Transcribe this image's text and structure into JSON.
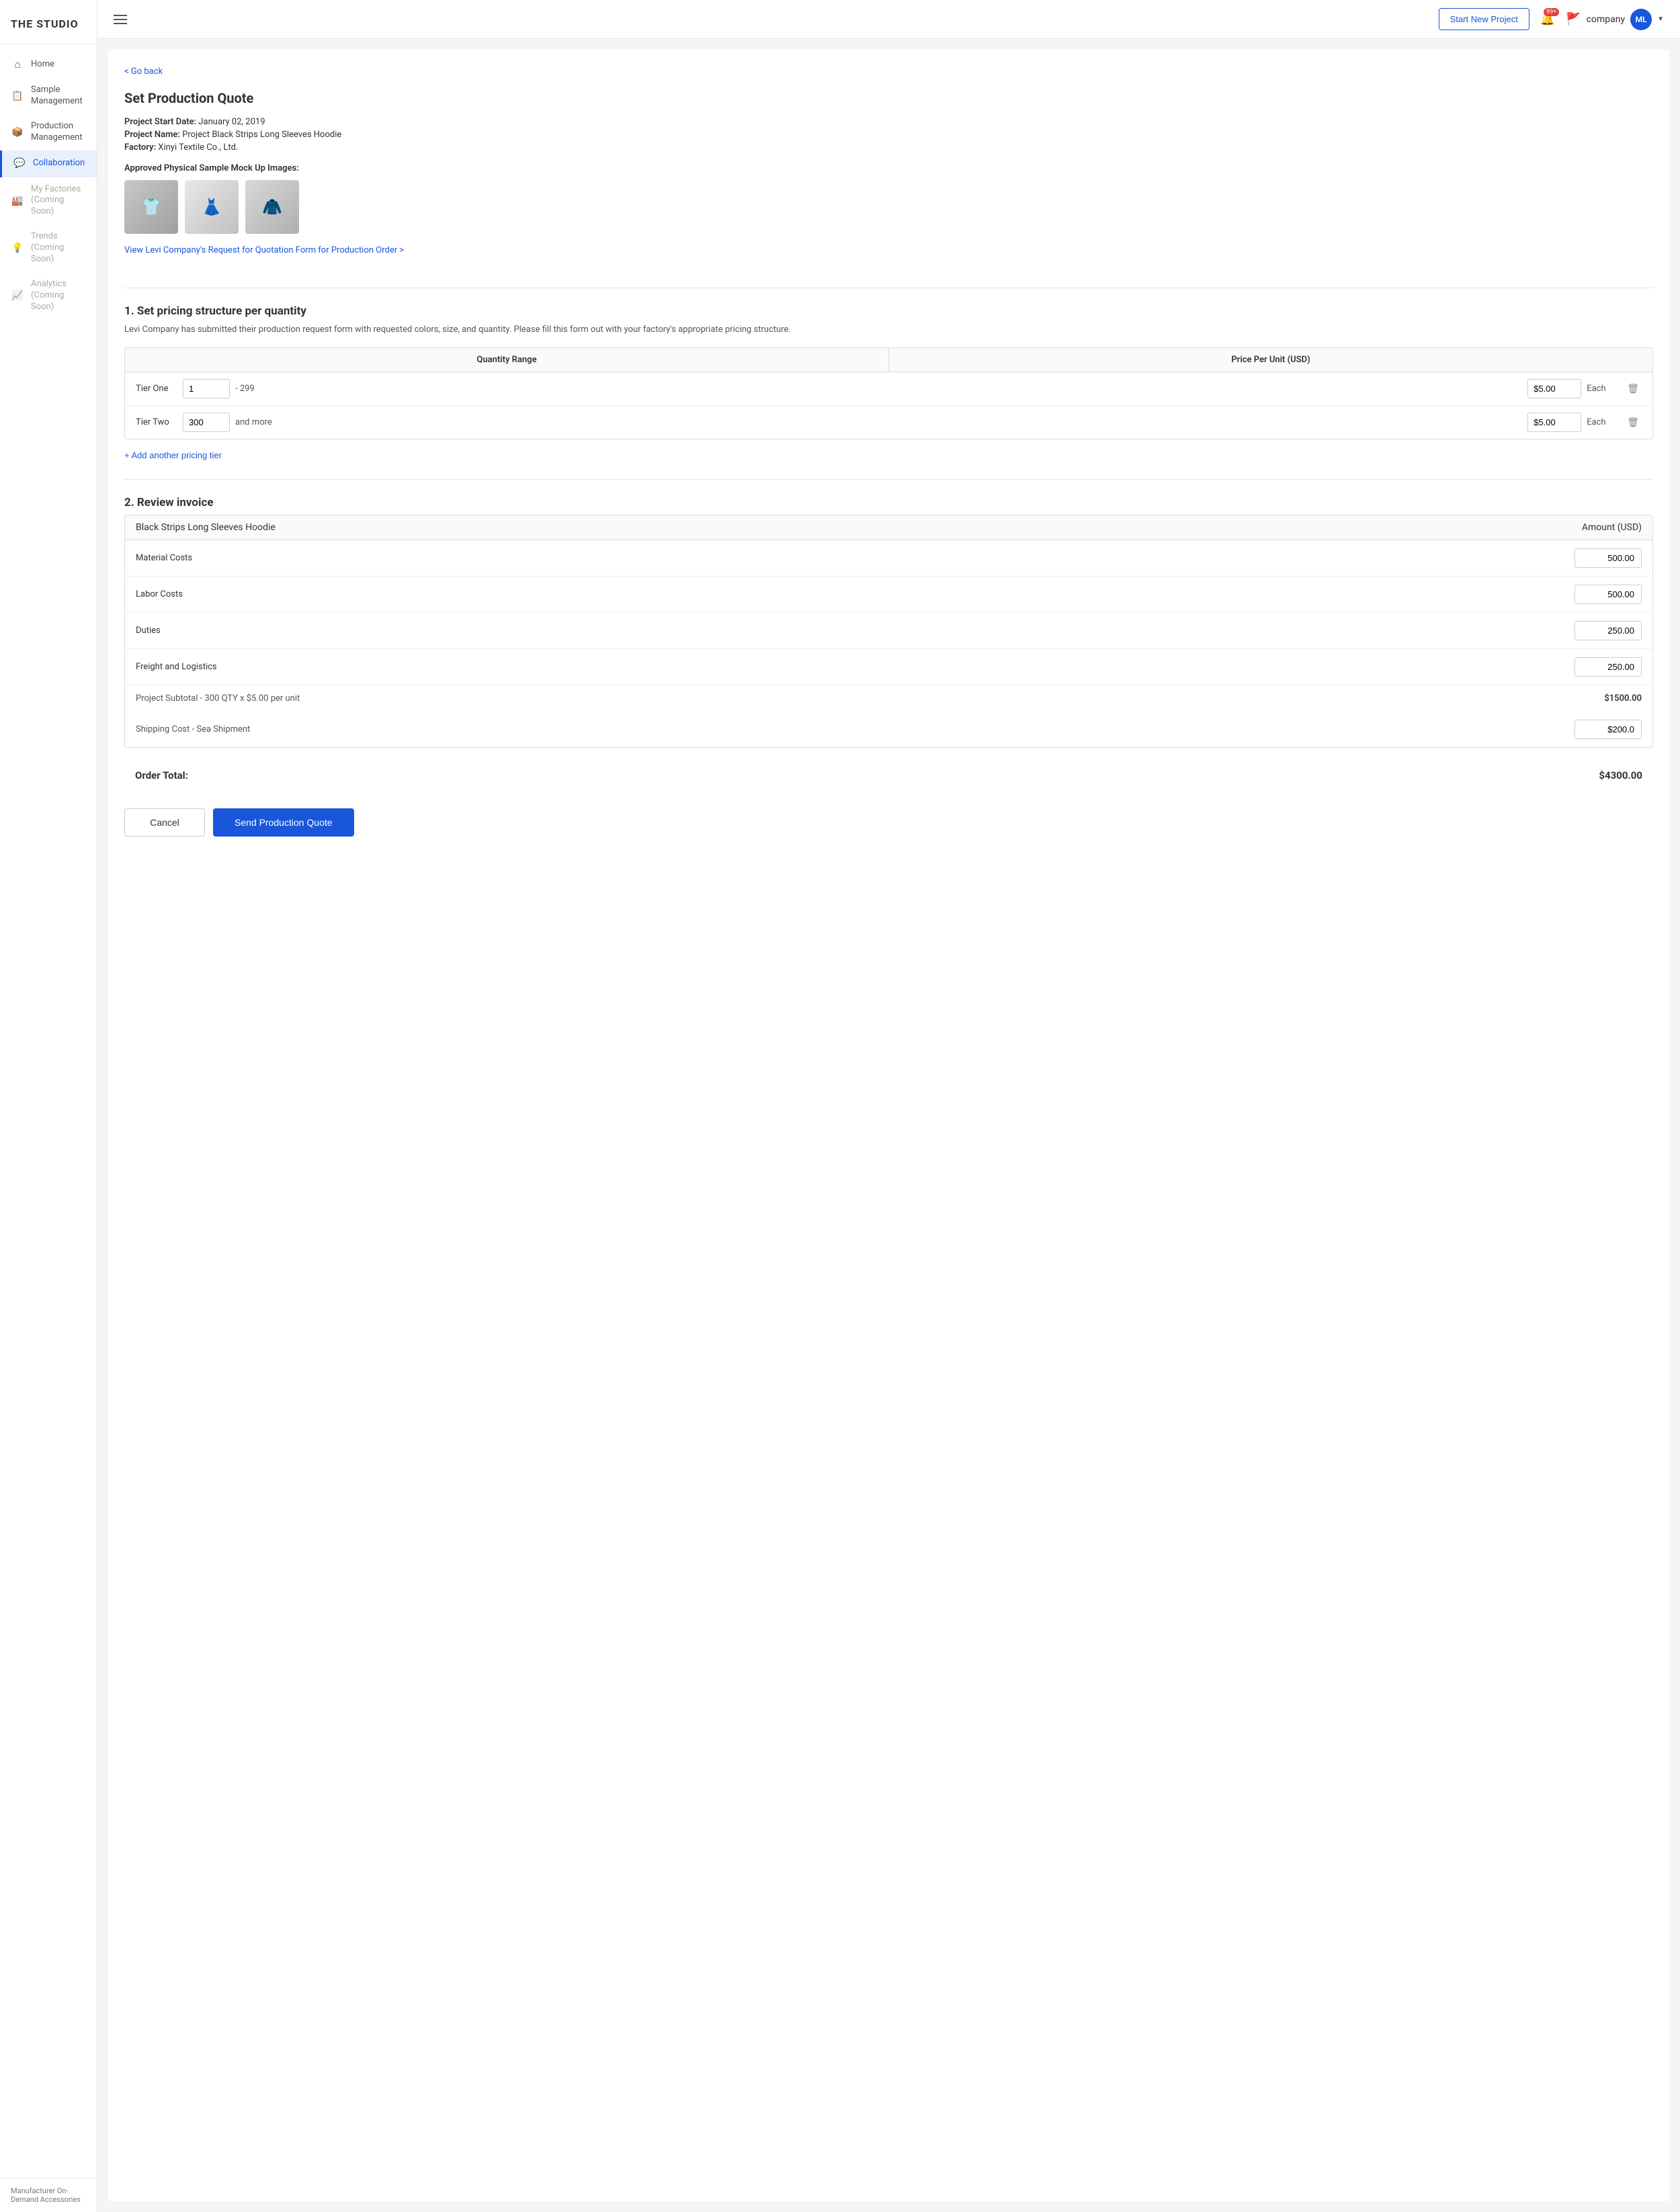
{
  "app": {
    "logo": "THE STUDIO"
  },
  "header": {
    "start_new_project": "Start New Project",
    "notification_count": "99+",
    "company_name": "company",
    "user_initials": "ML"
  },
  "sidebar": {
    "items": [
      {
        "id": "home",
        "label": "Home",
        "icon": "home",
        "active": false,
        "disabled": false
      },
      {
        "id": "sample-management",
        "label": "Sample Management",
        "icon": "sample",
        "active": false,
        "disabled": false
      },
      {
        "id": "production-management",
        "label": "Production Management",
        "icon": "production",
        "active": false,
        "disabled": false
      },
      {
        "id": "collaboration",
        "label": "Collaboration",
        "icon": "collab",
        "active": true,
        "disabled": false
      },
      {
        "id": "my-factories",
        "label": "My Factories (Coming Soon)",
        "icon": "factory",
        "active": false,
        "disabled": true
      },
      {
        "id": "trends",
        "label": "Trends (Coming Soon)",
        "icon": "trends",
        "active": false,
        "disabled": true
      },
      {
        "id": "analytics",
        "label": "Analytics (Coming Soon)",
        "icon": "analytics",
        "active": false,
        "disabled": true
      }
    ],
    "footer_label": "Manufacturer On-Demand Accessories"
  },
  "page": {
    "go_back": "< Go back",
    "title": "Set Production Quote",
    "project_start_date_label": "Project Start Date:",
    "project_start_date": "January 02, 2019",
    "project_name_label": "Project Name:",
    "project_name": "Project Black Strips Long Sleeves Hoodie",
    "factory_label": "Factory:",
    "factory": "Xinyi Textile Co., Ltd.",
    "sample_images_label": "Approved Physical Sample Mock Up Images:",
    "rfq_link": "View Levi Company's Request for Quotation Form for Production Order >"
  },
  "section1": {
    "title": "1. Set pricing structure per quantity",
    "description": "Levi Company has submitted their production request form with requested colors, size, and quantity. Please fill this form out with your factory's appropriate pricing structure.",
    "table_headers": {
      "qty_range": "Quantity Range",
      "price_per_unit": "Price Per Unit (USD)"
    },
    "tiers": [
      {
        "label": "Tier One",
        "from": "1",
        "to": "- 299",
        "price": "$5.00",
        "unit": "Each"
      },
      {
        "label": "Tier Two",
        "from": "300",
        "to": "and more",
        "price": "$5.00",
        "unit": "Each"
      }
    ],
    "add_tier_label": "+ Add another pricing tier"
  },
  "section2": {
    "title": "2. Review invoice",
    "invoice_product": "Black Strips Long Sleeves Hoodie",
    "invoice_amount_header": "Amount (USD)",
    "line_items": [
      {
        "label": "Material Costs",
        "value": "500.00"
      },
      {
        "label": "Labor Costs",
        "value": "500.00"
      },
      {
        "label": "Duties",
        "value": "250.00"
      },
      {
        "label": "Freight and Logistics",
        "value": "250.00"
      }
    ],
    "subtotal_label": "Project Subtotal - 300 QTY x $5.00 per unit",
    "subtotal_value": "$1500.00",
    "shipping_label": "Shipping Cost - Sea Shipment",
    "shipping_value": "$200.0",
    "order_total_label": "Order Total:",
    "order_total_value": "$4300.00"
  },
  "footer": {
    "cancel_label": "Cancel",
    "send_quote_label": "Send Production Quote"
  }
}
